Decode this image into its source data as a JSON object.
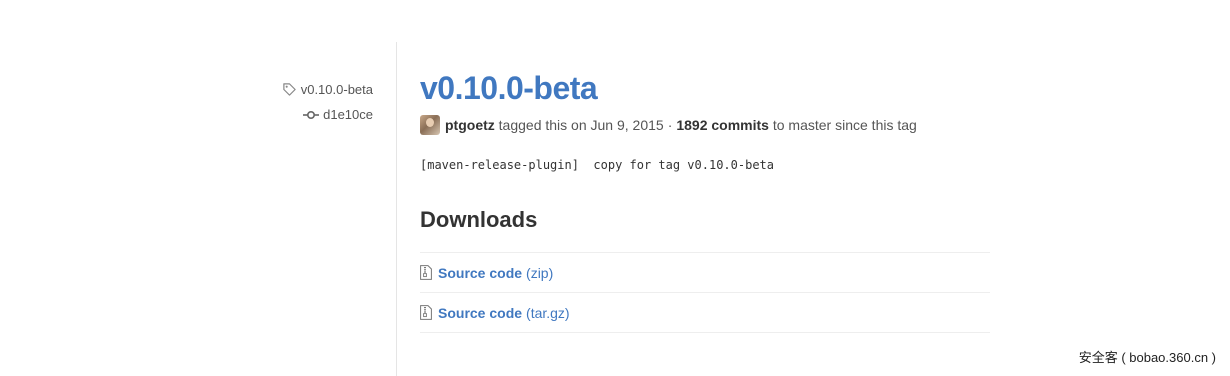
{
  "sidebar": {
    "tag_label": "v0.10.0-beta",
    "commit_label": "d1e10ce"
  },
  "release": {
    "title": "v0.10.0-beta",
    "author": "ptgoetz",
    "tagged_text": "tagged this on Jun 9, 2015",
    "separator": "·",
    "commits_count": "1892 commits",
    "commits_suffix": "to master since this tag",
    "message": "[maven-release-plugin]  copy for tag v0.10.0-beta"
  },
  "downloads": {
    "heading": "Downloads",
    "items": [
      {
        "name": "Source code",
        "format": "(zip)",
        "icon": "zip-file-icon"
      },
      {
        "name": "Source code",
        "format": "(tar.gz)",
        "icon": "zip-file-icon"
      }
    ]
  },
  "watermark": "安全客 ( bobao.360.cn )",
  "colors": {
    "link": "#4078c0",
    "text": "#333333",
    "muted": "#555555",
    "border": "#eeeeee"
  }
}
